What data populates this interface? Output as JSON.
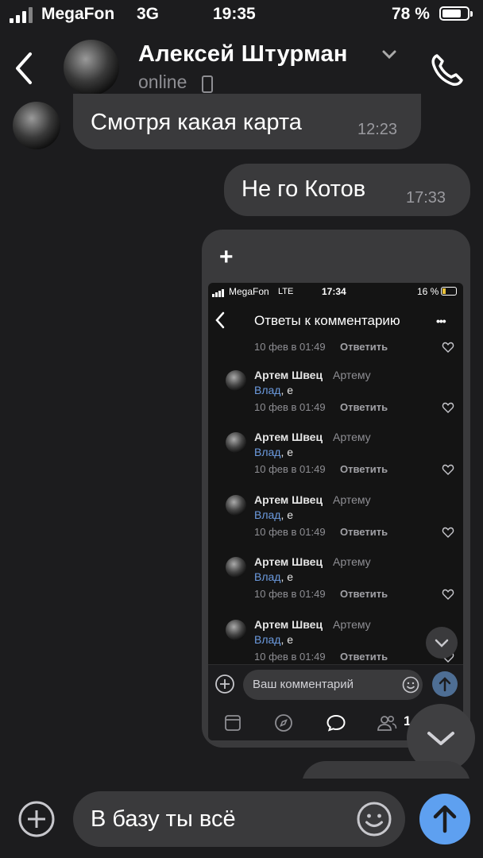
{
  "status_bar": {
    "carrier": "MegaFon",
    "network": "3G",
    "time": "19:35",
    "battery": "78 %",
    "battery_level": 0.78
  },
  "header": {
    "name": "Алексей Штурман",
    "status": "online"
  },
  "messages": [
    {
      "text": "Смотря какая карта",
      "time": "12:23",
      "side": "incoming"
    },
    {
      "text": "Не го Котов",
      "time": "17:33",
      "side": "outgoing"
    }
  ],
  "screenshot": {
    "plus": "+",
    "status": {
      "carrier": "MegaFon",
      "network": "LTE",
      "time": "17:34",
      "battery": "16 %"
    },
    "title": "Ответы к комментарию",
    "more": "•••",
    "first_meta": {
      "date": "10 фев в 01:49",
      "reply": "Ответить"
    },
    "replies": [
      {
        "author": "Артем Швец",
        "to": "Артему",
        "mention": "Влад",
        "rest": ", е",
        "date": "10 фев в 01:49",
        "reply": "Ответить"
      },
      {
        "author": "Артем Швец",
        "to": "Артему",
        "mention": "Влад",
        "rest": ", е",
        "date": "10 фев в 01:49",
        "reply": "Ответить"
      },
      {
        "author": "Артем Швец",
        "to": "Артему",
        "mention": "Влад",
        "rest": ", е",
        "date": "10 фев в 01:49",
        "reply": "Ответить"
      },
      {
        "author": "Артем Швец",
        "to": "Артему",
        "mention": "Влад",
        "rest": ", е",
        "date": "10 фев в 01:49",
        "reply": "Ответить"
      },
      {
        "author": "Артем Швец",
        "to": "Артему",
        "mention": "Влад",
        "rest": ", е",
        "date": "10 фев в 01:49",
        "reply": "Ответить"
      }
    ],
    "comment_placeholder": "Ваш комментарий",
    "tab_badge": "1"
  },
  "composer": {
    "value": "В базу ты всё"
  },
  "colors": {
    "background": "#1c1c1e",
    "bubble": "#3a3a3c",
    "accent": "#5ea0f0",
    "link": "#6c9be0"
  },
  "icons": [
    "back-icon",
    "chevron-down-icon",
    "phone-icon",
    "plus-icon",
    "smile-icon",
    "send-icon"
  ]
}
